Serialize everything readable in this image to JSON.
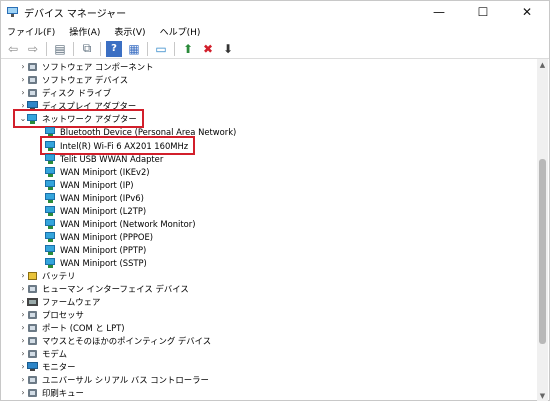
{
  "window": {
    "title": "デバイス マネージャー",
    "minimize": "—",
    "maximize": "☐",
    "close": "✕"
  },
  "menu": {
    "file": "ファイル(F)",
    "action": "操作(A)",
    "view": "表示(V)",
    "help": "ヘルプ(H)"
  },
  "toolbar": {
    "back": "⇦",
    "forward": "⇨",
    "props": "▤",
    "console": "⧉",
    "help": "?",
    "scan": "▦",
    "monitor": "▭",
    "update": "⬆",
    "remove": "✖",
    "download": "⬇"
  },
  "tree": {
    "chevron_collapsed": "›",
    "chevron_expanded": "⌄",
    "top_categories": [
      {
        "label": "ソフトウェア コンポーネント"
      },
      {
        "label": "ソフトウェア デバイス"
      },
      {
        "label": "ディスク ドライブ"
      },
      {
        "label": "ディスプレイ アダプター"
      }
    ],
    "network": {
      "label": "ネットワーク アダプター",
      "children": [
        "Bluetooth Device (Personal Area Network)",
        "Intel(R) Wi-Fi 6 AX201 160MHz",
        "Telit USB WWAN Adapter",
        "WAN Miniport (IKEv2)",
        "WAN Miniport (IP)",
        "WAN Miniport (IPv6)",
        "WAN Miniport (L2TP)",
        "WAN Miniport (Network Monitor)",
        "WAN Miniport (PPPOE)",
        "WAN Miniport (PPTP)",
        "WAN Miniport (SSTP)"
      ]
    },
    "bottom_categories": [
      "バッテリ",
      "ヒューマン インターフェイス デバイス",
      "ファームウェア",
      "プロセッサ",
      "ポート (COM と LPT)",
      "マウスとそのほかのポインティング デバイス",
      "モデム",
      "モニター",
      "ユニバーサル シリアル バス コントローラー",
      "印刷キュー"
    ]
  },
  "scroll": {
    "up": "▲",
    "down": "▼"
  }
}
